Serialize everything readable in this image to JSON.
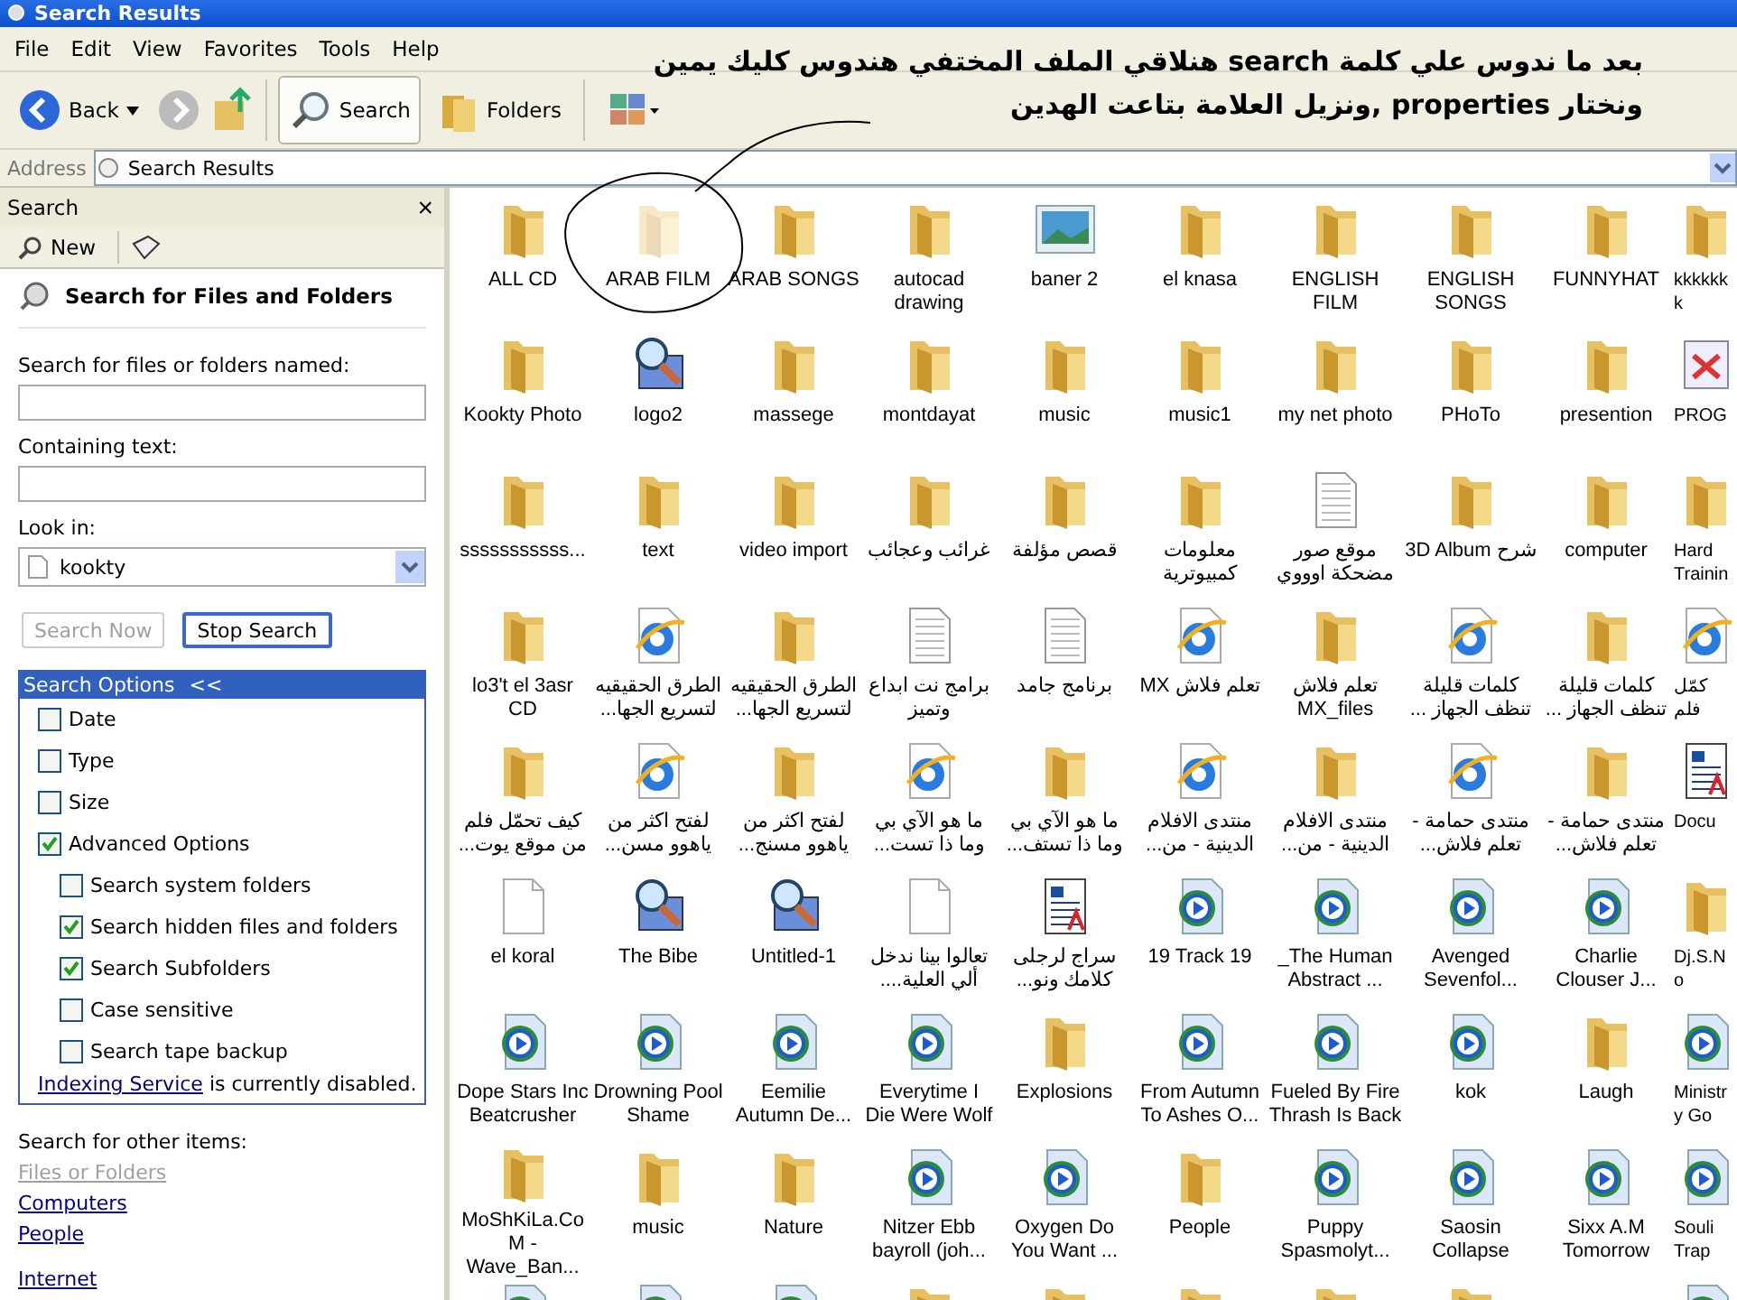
{
  "window": {
    "title": "Search Results"
  },
  "menu": [
    "File",
    "Edit",
    "View",
    "Favorites",
    "Tools",
    "Help"
  ],
  "toolbar": {
    "back": "Back",
    "search": "Search",
    "folders": "Folders",
    "search_selected": true
  },
  "address": {
    "label": "Address",
    "value": "Search Results"
  },
  "annotation": {
    "lines": [
      "بعد ما ندوس علي كلمة search هنلاقي الملف المختفي هندوس كليك يمين",
      "ونختار properties ,ونزيل العلامة بتاعت الهدين"
    ]
  },
  "search_pane": {
    "title": "Search",
    "close": "×",
    "new": "New",
    "heading": "Search for Files and Folders",
    "named_label": "Search for files or folders named:",
    "containing_label": "Containing text:",
    "look_in_label": "Look in:",
    "look_in_value": "kookty",
    "buttons": [
      {
        "label": "Search Now",
        "disabled": true
      },
      {
        "label": "Stop Search",
        "disabled": false
      }
    ],
    "options_title": "Search Options",
    "options_toggle": "<<",
    "options": [
      {
        "label": "Date",
        "checked": false
      },
      {
        "label": "Type",
        "checked": false
      },
      {
        "label": "Size",
        "checked": false
      },
      {
        "label": "Advanced Options",
        "checked": true,
        "children": [
          {
            "label": "Search system folders",
            "checked": false
          },
          {
            "label": "Search hidden files and folders",
            "checked": true
          },
          {
            "label": "Search Subfolders",
            "checked": true
          },
          {
            "label": "Case sensitive",
            "checked": false
          },
          {
            "label": "Search tape backup",
            "checked": false
          }
        ]
      }
    ],
    "indexing_link": "Indexing Service",
    "indexing_text": " is currently disabled.",
    "other_label": "Search for other items:",
    "other_links": [
      {
        "label": "Files or Folders",
        "disabled": true
      },
      {
        "label": "Computers",
        "disabled": false
      },
      {
        "label": "People",
        "disabled": false
      },
      {
        "label": "Internet",
        "disabled": false
      }
    ]
  },
  "files": [
    {
      "kind": "folder",
      "name": "ALL CD"
    },
    {
      "kind": "folder",
      "name": "ARAB  FILM",
      "hidden": true
    },
    {
      "kind": "folder",
      "name": "ARAB SONGS"
    },
    {
      "kind": "folder",
      "name": "autocad drawing"
    },
    {
      "kind": "picture",
      "name": "baner 2"
    },
    {
      "kind": "folder",
      "name": "el knasa"
    },
    {
      "kind": "folder",
      "name": "ENGLISH FILM"
    },
    {
      "kind": "folder",
      "name": "ENGLISH SONGS"
    },
    {
      "kind": "folder",
      "name": "FUNNYHAT"
    },
    {
      "kind": "folder",
      "name": "kkkkkkk"
    },
    {
      "kind": "folder",
      "name": "Kookty Photo"
    },
    {
      "kind": "imaging",
      "name": "logo2"
    },
    {
      "kind": "folder",
      "name": "massege"
    },
    {
      "kind": "folder",
      "name": "montdayat"
    },
    {
      "kind": "folder",
      "name": "music"
    },
    {
      "kind": "folder",
      "name": "music1"
    },
    {
      "kind": "folder",
      "name": "my net photo"
    },
    {
      "kind": "folder",
      "name": "PHoTo"
    },
    {
      "kind": "folder",
      "name": "presention"
    },
    {
      "kind": "app",
      "name": "PROG"
    },
    {
      "kind": "folder",
      "name": "sssssssssss..."
    },
    {
      "kind": "folder",
      "name": "text"
    },
    {
      "kind": "folder",
      "name": "video import"
    },
    {
      "kind": "folder",
      "name": "غرائب وعجائب"
    },
    {
      "kind": "folder",
      "name": "قصص مؤلفة"
    },
    {
      "kind": "folder",
      "name": "معلومات كمبيوترية"
    },
    {
      "kind": "textdoc",
      "name": "موقع صور مضحكة اوووي"
    },
    {
      "kind": "folder",
      "name": "3D Album شرح"
    },
    {
      "kind": "folder",
      "name": "computer"
    },
    {
      "kind": "folder",
      "name": "Hard Trainin"
    },
    {
      "kind": "folder",
      "name": "lo3't el 3asr CD"
    },
    {
      "kind": "web",
      "name": "الطرق الحقيقيه لتسريع الجها..."
    },
    {
      "kind": "folder",
      "name": "الطرق الحقيقيه لتسريع الجها..."
    },
    {
      "kind": "textdoc",
      "name": "برامج نت ابداع وتميز"
    },
    {
      "kind": "textdoc",
      "name": "برنامج جامد"
    },
    {
      "kind": "web",
      "name": "MX تعلم فلاش"
    },
    {
      "kind": "folder",
      "name": "تعلم فلاش MX_files"
    },
    {
      "kind": "web",
      "name": "كلمات قليلة تنظف الجهاز ..."
    },
    {
      "kind": "folder",
      "name": "كلمات قليلة تنظف الجهاز ..."
    },
    {
      "kind": "web",
      "name": "كمّل فلم"
    },
    {
      "kind": "folder",
      "name": "كيف تحمّل فلم من موقع يوت..."
    },
    {
      "kind": "web",
      "name": "لفتح اكثر من ياهوو مسن..."
    },
    {
      "kind": "folder",
      "name": "لفتح اكثر من ياهوو مسنج..."
    },
    {
      "kind": "web",
      "name": "ما هو الآي بي وما ذا تست..."
    },
    {
      "kind": "folder",
      "name": "ما هو الآي بي وما ذا تستف..."
    },
    {
      "kind": "web",
      "name": "منتدى الافلام الدينية - من..."
    },
    {
      "kind": "folder",
      "name": "منتدى الافلام الدينية - من..."
    },
    {
      "kind": "web",
      "name": "منتدى حمامة - تعلم فلاش..."
    },
    {
      "kind": "folder",
      "name": "منتدى حمامة - تعلم فلاش..."
    },
    {
      "kind": "worddoc",
      "name": "Docu"
    },
    {
      "kind": "blankdoc",
      "name": "el   koral"
    },
    {
      "kind": "imaging",
      "name": "The Bibe"
    },
    {
      "kind": "imaging",
      "name": "Untitled-1"
    },
    {
      "kind": "blankdoc",
      "name": "تعالوا بينا ندخل ألي العلية...."
    },
    {
      "kind": "worddoc",
      "name": "سراج لرجلى كلامك ونو..."
    },
    {
      "kind": "media",
      "name": "19 Track 19"
    },
    {
      "kind": "media",
      "name": "_The Human Abstract ..."
    },
    {
      "kind": "media",
      "name": "Avenged Sevenfol..."
    },
    {
      "kind": "media",
      "name": "Charlie Clouser J..."
    },
    {
      "kind": "folder",
      "name": "Dj.S.No"
    },
    {
      "kind": "media",
      "name": "Dope Stars Inc Beatcrusher"
    },
    {
      "kind": "media",
      "name": "Drowning Pool Shame"
    },
    {
      "kind": "media",
      "name": "Eemilie Autumn De..."
    },
    {
      "kind": "media",
      "name": "Everytime I Die Were Wolf"
    },
    {
      "kind": "folder",
      "name": "Explosions"
    },
    {
      "kind": "media",
      "name": "From Autumn To Ashes O..."
    },
    {
      "kind": "media",
      "name": "Fueled By Fire Thrash Is Back"
    },
    {
      "kind": "media",
      "name": "kok"
    },
    {
      "kind": "folder",
      "name": "Laugh"
    },
    {
      "kind": "media",
      "name": "Ministry Go"
    },
    {
      "kind": "folder",
      "name": "MoShKiLa.CoM - Wave_Ban..."
    },
    {
      "kind": "folder",
      "name": "music"
    },
    {
      "kind": "folder",
      "name": "Nature"
    },
    {
      "kind": "media",
      "name": "Nitzer Ebb bayroll (joh..."
    },
    {
      "kind": "media",
      "name": "Oxygen Do You Want ..."
    },
    {
      "kind": "folder",
      "name": "People"
    },
    {
      "kind": "media",
      "name": "Puppy Spasmolyt..."
    },
    {
      "kind": "media",
      "name": "Saosin Collapse"
    },
    {
      "kind": "media",
      "name": "Sixx A.M Tomorrow"
    },
    {
      "kind": "media",
      "name": "Souli Trap"
    },
    {
      "kind": "media"
    },
    {
      "kind": "media"
    },
    {
      "kind": "media"
    },
    {
      "kind": "folder"
    },
    {
      "kind": "folder"
    },
    {
      "kind": "folder"
    },
    {
      "kind": "folder"
    },
    {
      "kind": "folder"
    },
    {
      "kind": "none"
    },
    {
      "kind": "media"
    }
  ]
}
